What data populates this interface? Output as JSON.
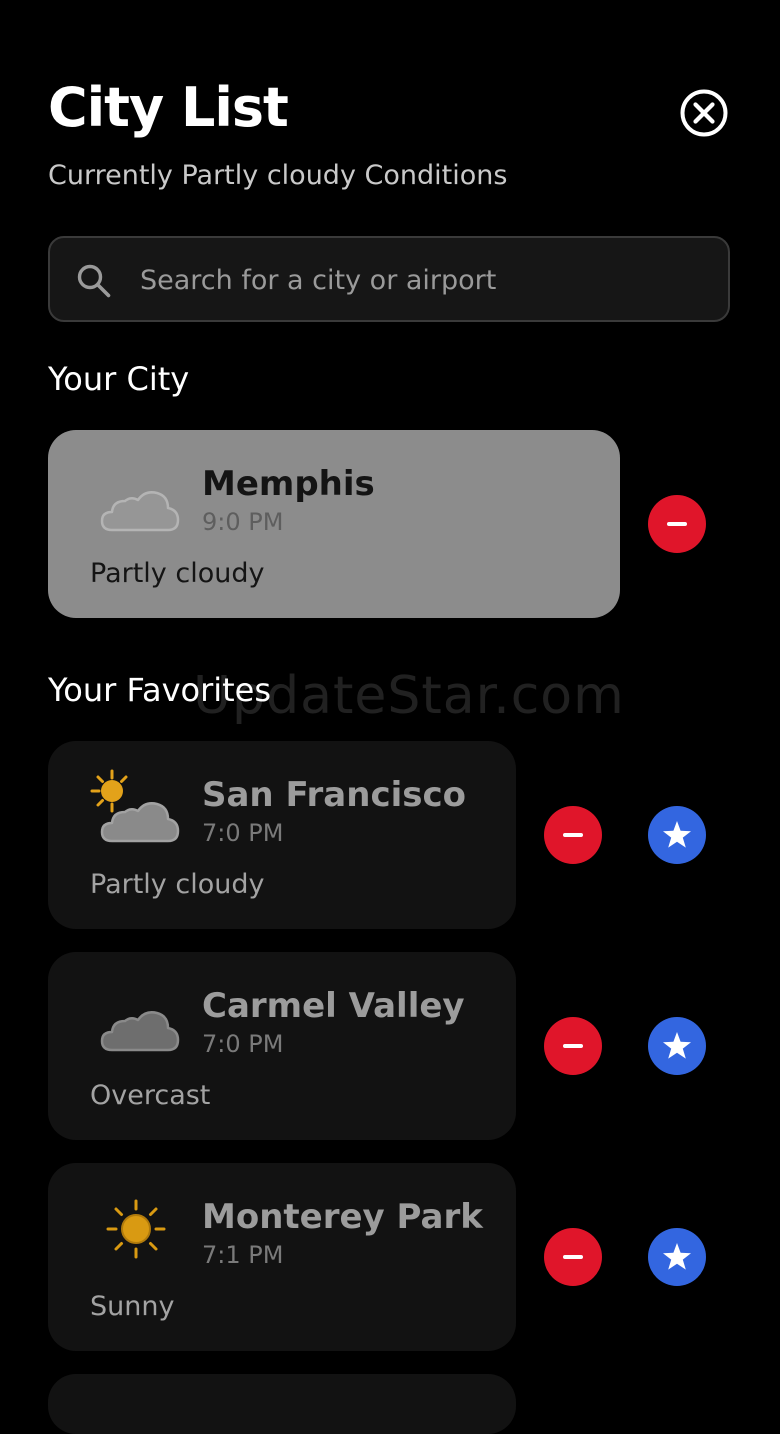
{
  "header": {
    "title": "City List",
    "subtitle": "Currently Partly cloudy Conditions",
    "close_icon": "close-circle-icon"
  },
  "search": {
    "placeholder": "Search for a city or airport",
    "value": "",
    "icon": "search-icon"
  },
  "your_city": {
    "heading": "Your City",
    "city": {
      "name": "Memphis",
      "time": "9:0 PM",
      "condition": "Partly cloudy",
      "icon": "moon-cloud-icon"
    }
  },
  "favorites": {
    "heading": "Your Favorites",
    "items": [
      {
        "name": "San Francisco",
        "time": "7:0 PM",
        "condition": "Partly cloudy",
        "icon": "sun-cloud-icon"
      },
      {
        "name": "Carmel Valley",
        "time": "7:0 PM",
        "condition": "Overcast",
        "icon": "cloud-icon"
      },
      {
        "name": "Monterey Park",
        "time": "7:1 PM",
        "condition": "Sunny",
        "icon": "sun-icon"
      }
    ]
  },
  "watermark": "UpdateStar.com",
  "colors": {
    "background": "#000000",
    "remove": "#e0152a",
    "favorite": "#3366e0",
    "current_card": "#8c8c8c",
    "card": "#121212"
  }
}
